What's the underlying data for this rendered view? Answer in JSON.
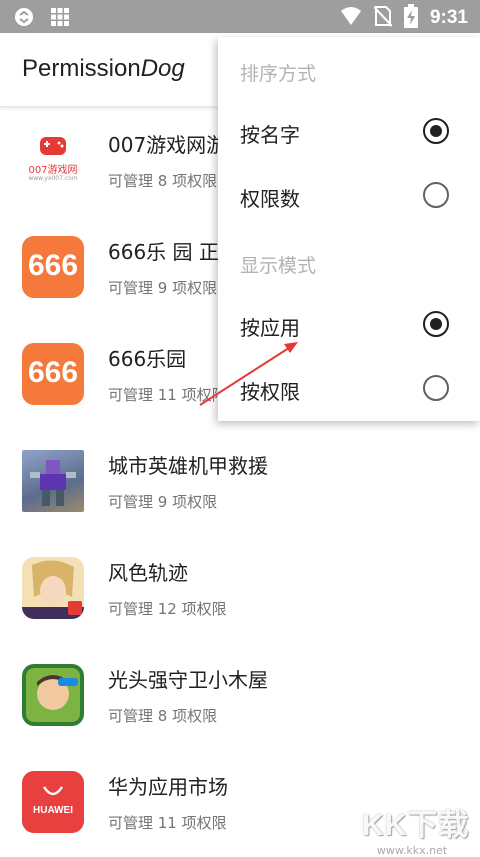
{
  "status_bar": {
    "time": "9:31",
    "icons": [
      "cast-icon",
      "grid-icon",
      "wifi-icon",
      "no-sim-icon",
      "battery-charging-icon"
    ]
  },
  "app_bar": {
    "title_plain": "Permission",
    "title_italic": "Dog"
  },
  "apps": [
    {
      "name": "007游戏网游",
      "subtitle": "可管理 8 项权限",
      "icon": "007-game-icon",
      "icon_text": "007游戏网",
      "icon_subtext": "www.yx007.com",
      "icon_color": "#e53935"
    },
    {
      "name": "666乐 园 正",
      "subtitle": "可管理 9 项权限",
      "icon": "666-icon",
      "icon_text": "666",
      "icon_color": "#f4793a"
    },
    {
      "name": "666乐园",
      "subtitle": "可管理 11 项权限",
      "icon": "666-icon",
      "icon_text": "666",
      "icon_color": "#f4793a"
    },
    {
      "name": "城市英雄机甲救援",
      "subtitle": "可管理 9 项权限",
      "icon": "mecha-game-icon",
      "icon_color": "#5c6bc0"
    },
    {
      "name": "风色轨迹",
      "subtitle": "可管理 12 项权限",
      "icon": "anime-game-icon",
      "icon_color": "#c49a5a"
    },
    {
      "name": "光头强守卫小木屋",
      "subtitle": "可管理 8 项权限",
      "icon": "bear-game-icon",
      "icon_color": "#43a047"
    },
    {
      "name": "华为应用市场",
      "subtitle": "可管理 11 项权限",
      "icon": "huawei-appgallery-icon",
      "icon_text": "HUAWEI",
      "icon_color": "#e8403e"
    }
  ],
  "menu": {
    "sort_header": "排序方式",
    "sort_options": [
      {
        "label": "按名字",
        "checked": true
      },
      {
        "label": "权限数",
        "checked": false
      }
    ],
    "display_header": "显示模式",
    "display_options": [
      {
        "label": "按应用",
        "checked": true
      },
      {
        "label": "按权限",
        "checked": false
      }
    ]
  },
  "watermark": {
    "text": "KK下载",
    "url": "www.kkx.net"
  },
  "colors": {
    "status_bar": "#9e9e9e",
    "annotation_arrow": "#e53935",
    "accent_orange": "#f4793a"
  }
}
